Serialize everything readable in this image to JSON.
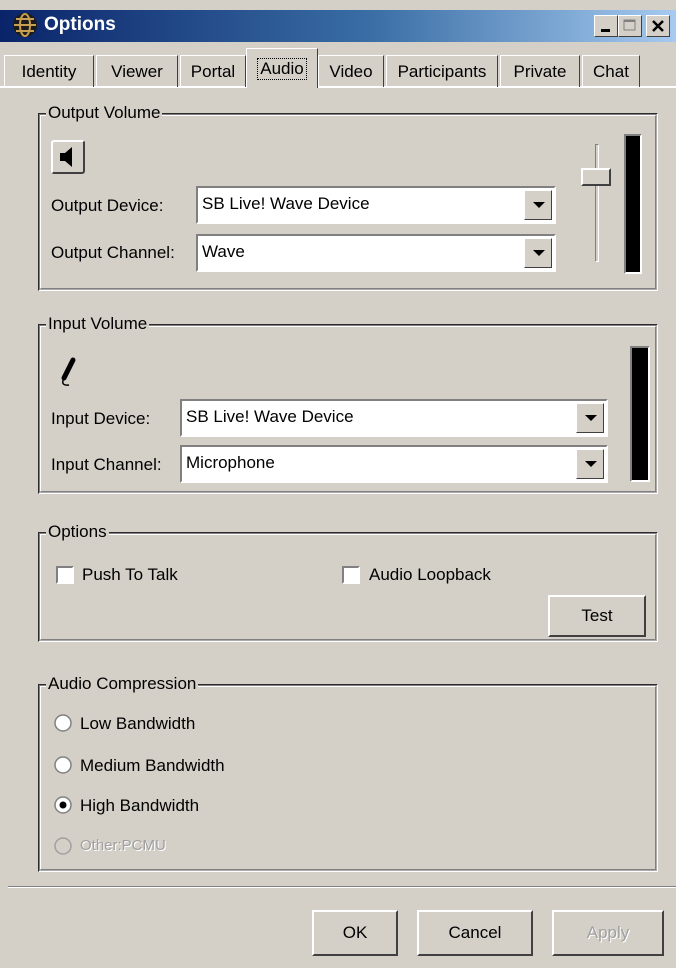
{
  "window": {
    "title": "Options"
  },
  "tabs": [
    {
      "label": "Identity"
    },
    {
      "label": "Viewer"
    },
    {
      "label": "Portal"
    },
    {
      "label": "Audio",
      "active": true
    },
    {
      "label": "Video"
    },
    {
      "label": "Participants"
    },
    {
      "label": "Private"
    },
    {
      "label": "Chat"
    }
  ],
  "output": {
    "legend": "Output Volume",
    "device_label": "Output Device:",
    "device_value": "SB Live! Wave Device",
    "channel_label": "Output Channel:",
    "channel_value": "Wave"
  },
  "input": {
    "legend": "Input Volume",
    "device_label": "Input Device:",
    "device_value": "SB Live! Wave Device",
    "channel_label": "Input Channel:",
    "channel_value": "Microphone"
  },
  "options": {
    "legend": "Options",
    "push_to_talk": {
      "label": "Push To Talk",
      "checked": false
    },
    "audio_loopback": {
      "label": "Audio Loopback",
      "checked": false
    },
    "test_label": "Test"
  },
  "compression": {
    "legend": "Audio Compression",
    "low": {
      "label": "Low Bandwidth",
      "checked": false
    },
    "medium": {
      "label": "Medium Bandwidth",
      "checked": false
    },
    "high": {
      "label": "High Bandwidth",
      "checked": true
    },
    "other": {
      "label": "Other:PCMU",
      "checked": false,
      "enabled": false
    }
  },
  "footer": {
    "ok": "OK",
    "cancel": "Cancel",
    "apply": "Apply"
  }
}
